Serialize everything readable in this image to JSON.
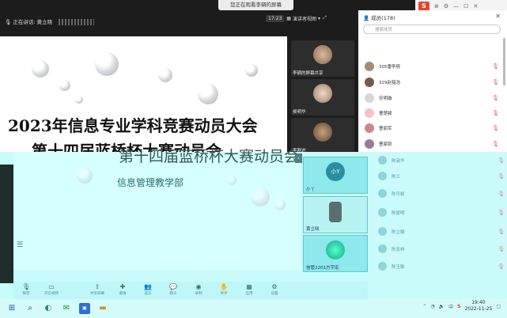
{
  "window": {
    "share_banner": "您正在观看李碉的屏幕",
    "speaking_label": "正在讲话: 黄立晓",
    "timer": "17:23",
    "view_mode": "演讲者视图"
  },
  "slide": {
    "title_line1": "2023年信息专业学科竞赛动员大会",
    "title_line2": "第十四届蓝桥杯大赛动员会",
    "title_overlap": "第十四届蓝桥杯大赛动员会",
    "department": "信息管理教学部"
  },
  "video_tiles_top": [
    {
      "name": "李碉的屏幕共享"
    },
    {
      "name": "侯明华"
    },
    {
      "name": "李刚进"
    }
  ],
  "video_tiles_bottom": [
    {
      "name": "小丫",
      "avatar_text": "小Y"
    },
    {
      "name": "黄立晓"
    },
    {
      "name": "信管2201方宇宏"
    }
  ],
  "members": {
    "header": "成员(178)",
    "search_placeholder": "搜索成员",
    "list": [
      {
        "name": "305雷李倩"
      },
      {
        "name": "329赵蕴浩"
      },
      {
        "name": "安明璇"
      },
      {
        "name": "曹楚颖"
      },
      {
        "name": "曹丽军"
      },
      {
        "name": "曹家蔚"
      }
    ],
    "list_faded": [
      {
        "name": "陈淑华"
      },
      {
        "name": "陈兰"
      },
      {
        "name": "陈可颖"
      },
      {
        "name": "陈家明"
      },
      {
        "name": "陈立娟"
      },
      {
        "name": "陈忠林"
      },
      {
        "name": "陈玉敏"
      }
    ]
  },
  "controls": [
    {
      "label": "静音",
      "icon": "mic-icon"
    },
    {
      "label": "开启视频",
      "icon": "camera-icon"
    },
    {
      "label": "共享屏幕",
      "icon": "share-icon"
    },
    {
      "label": "邀请",
      "icon": "invite-icon"
    },
    {
      "label": "成员",
      "icon": "members-icon"
    },
    {
      "label": "聊天",
      "icon": "chat-icon"
    },
    {
      "label": "录制",
      "icon": "record-icon"
    },
    {
      "label": "举手",
      "icon": "hand-icon"
    },
    {
      "label": "应用",
      "icon": "apps-icon"
    },
    {
      "label": "设置",
      "icon": "settings-icon"
    }
  ],
  "taskbar": {
    "time": "19:40",
    "date": "2022-11-25",
    "ime": "中"
  }
}
